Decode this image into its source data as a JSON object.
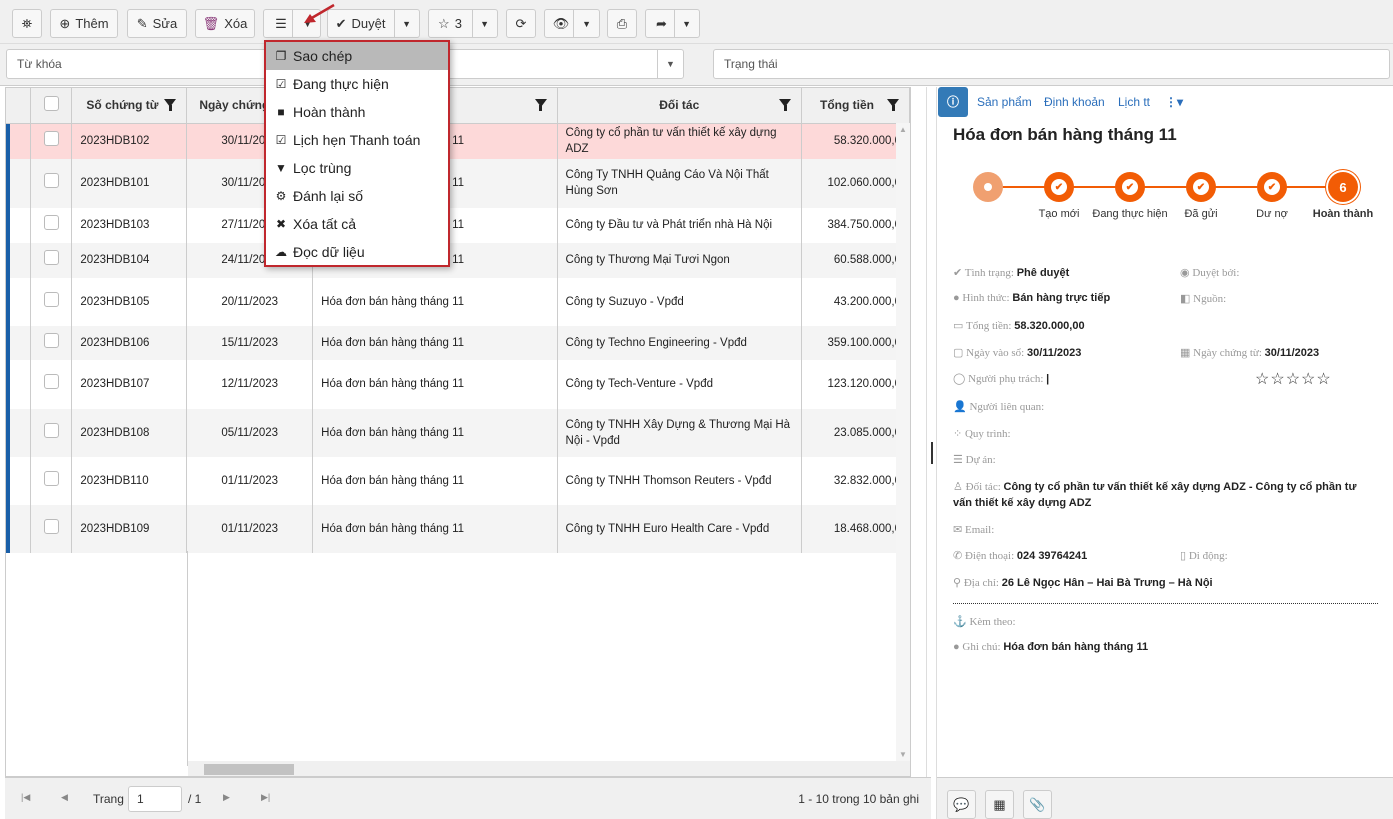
{
  "toolbar": {
    "search_icon": "binoculars-icon",
    "add": "Thêm",
    "edit": "Sửa",
    "delete": "Xóa",
    "approve": "Duyệt",
    "star_count": "3"
  },
  "menu": {
    "items": [
      {
        "label": "Sao chép",
        "icon": "copy-icon"
      },
      {
        "label": "Đang thực hiện",
        "icon": "checkbox-outline-icon"
      },
      {
        "label": "Hoàn thành",
        "icon": "checkbox-checked-icon"
      },
      {
        "label": "Lịch hẹn Thanh toán",
        "icon": "calendar-check-icon"
      },
      {
        "label": "Lọc trùng",
        "icon": "filter-icon"
      },
      {
        "label": "Đánh lại số",
        "icon": "cogs-icon"
      },
      {
        "label": "Xóa tất cả",
        "icon": "times-circle-icon"
      },
      {
        "label": "Đọc dữ liệu",
        "icon": "cloud-download-icon"
      }
    ]
  },
  "filters": {
    "keyword_placeholder": "Từ khóa",
    "status_placeholder": "Trạng thái"
  },
  "table": {
    "columns": [
      "Số chứng từ",
      "Ngày chứng từ",
      "",
      "Đối tác",
      "Tổng tiền"
    ],
    "rows": [
      [
        "2023HDB102",
        "30/11/2023",
        "Hóa đơn bán hàng tháng 11",
        "Công ty cổ phần tư vấn thiết kế xây dựng ADZ",
        "58.320.000,0"
      ],
      [
        "2023HDB101",
        "30/11/2023",
        "Hóa đơn bán hàng tháng 11",
        "Công Ty TNHH Quảng Cáo Và Nội Thất Hùng Sơn",
        "102.060.000,0"
      ],
      [
        "2023HDB103",
        "27/11/2023",
        "Hóa đơn bán hàng tháng 11",
        "Công ty Đầu tư và Phát triển nhà Hà Nội",
        "384.750.000,0"
      ],
      [
        "2023HDB104",
        "24/11/2023",
        "Hóa đơn bán hàng tháng 11",
        "Công ty Thương Mại Tươi Ngon",
        "60.588.000,0"
      ],
      [
        "2023HDB105",
        "20/11/2023",
        "Hóa đơn bán hàng tháng 11",
        "Công ty Suzuyo - Vpđd",
        "43.200.000,0"
      ],
      [
        "2023HDB106",
        "15/11/2023",
        "Hóa đơn bán hàng tháng 11",
        "Công ty Techno Engineering - Vpđd",
        "359.100.000,0"
      ],
      [
        "2023HDB107",
        "12/11/2023",
        "Hóa đơn bán hàng tháng 11",
        "Công ty Tech-Venture - Vpđd",
        "123.120.000,0"
      ],
      [
        "2023HDB108",
        "05/11/2023",
        "Hóa đơn bán hàng tháng 11",
        "Công ty TNHH Xây Dựng & Thương Mại Hà Nội - Vpđd",
        "23.085.000,0"
      ],
      [
        "2023HDB110",
        "01/11/2023",
        "Hóa đơn bán hàng tháng 11",
        "Công ty TNHH Thomson Reuters - Vpđd",
        "32.832.000,0"
      ],
      [
        "2023HDB109",
        "01/11/2023",
        "Hóa đơn bán hàng tháng 11",
        "Công ty TNHH Euro Health Care - Vpđd",
        "18.468.000,0"
      ]
    ],
    "selected_row_color": "#fdd9d9"
  },
  "pager": {
    "page_label": "Trang",
    "page": "1",
    "total_pages": "/ 1",
    "summary": "1 - 10 trong 10 bản ghi"
  },
  "detail": {
    "tabs": [
      "Sản phẩm",
      "Định khoản",
      "Lịch tt"
    ],
    "title": "Hóa đơn bán hàng tháng 11",
    "steps": [
      "Tạo mới",
      "Đang thực hiện",
      "Đã gửi",
      "Dư nợ",
      "Hoàn thành"
    ],
    "current_step": "6",
    "accent": "#f25c05",
    "fields": {
      "status_l": "Tình trạng:",
      "status": "Phê duyệt",
      "approver_l": "Duyệt bởi:",
      "form_l": "Hình thức:",
      "form": "Bán hàng trực tiếp",
      "source_l": "Nguồn:",
      "total_l": "Tổng tiền:",
      "total": "58.320.000,00",
      "entry_l": "Ngày vào sổ:",
      "entry": "30/11/2023",
      "docdate_l": "Ngày chứng từ:",
      "docdate": "30/11/2023",
      "owner_l": "Người phụ trách:",
      "owner": "|",
      "rating": 0,
      "related_l": "Người liên quan:",
      "process_l": "Quy trình:",
      "project_l": "Dự án:",
      "partner_l": "Đối tác:",
      "partner": "Công ty cổ phần tư vấn thiết kế xây dựng ADZ - Công ty cổ phần tư vấn thiết kế xây dựng ADZ",
      "email_l": "Email:",
      "phone_l": "Điện thoại:",
      "phone": "024 39764241",
      "mobile_l": "Di động:",
      "address_l": "Địa chỉ:",
      "address": "26 Lê Ngọc Hân – Hai Bà Trưng – Hà Nội",
      "attach_l": "Kèm theo:",
      "note_l": "Ghi chú:",
      "note": "Hóa đơn bán hàng tháng 11"
    }
  }
}
